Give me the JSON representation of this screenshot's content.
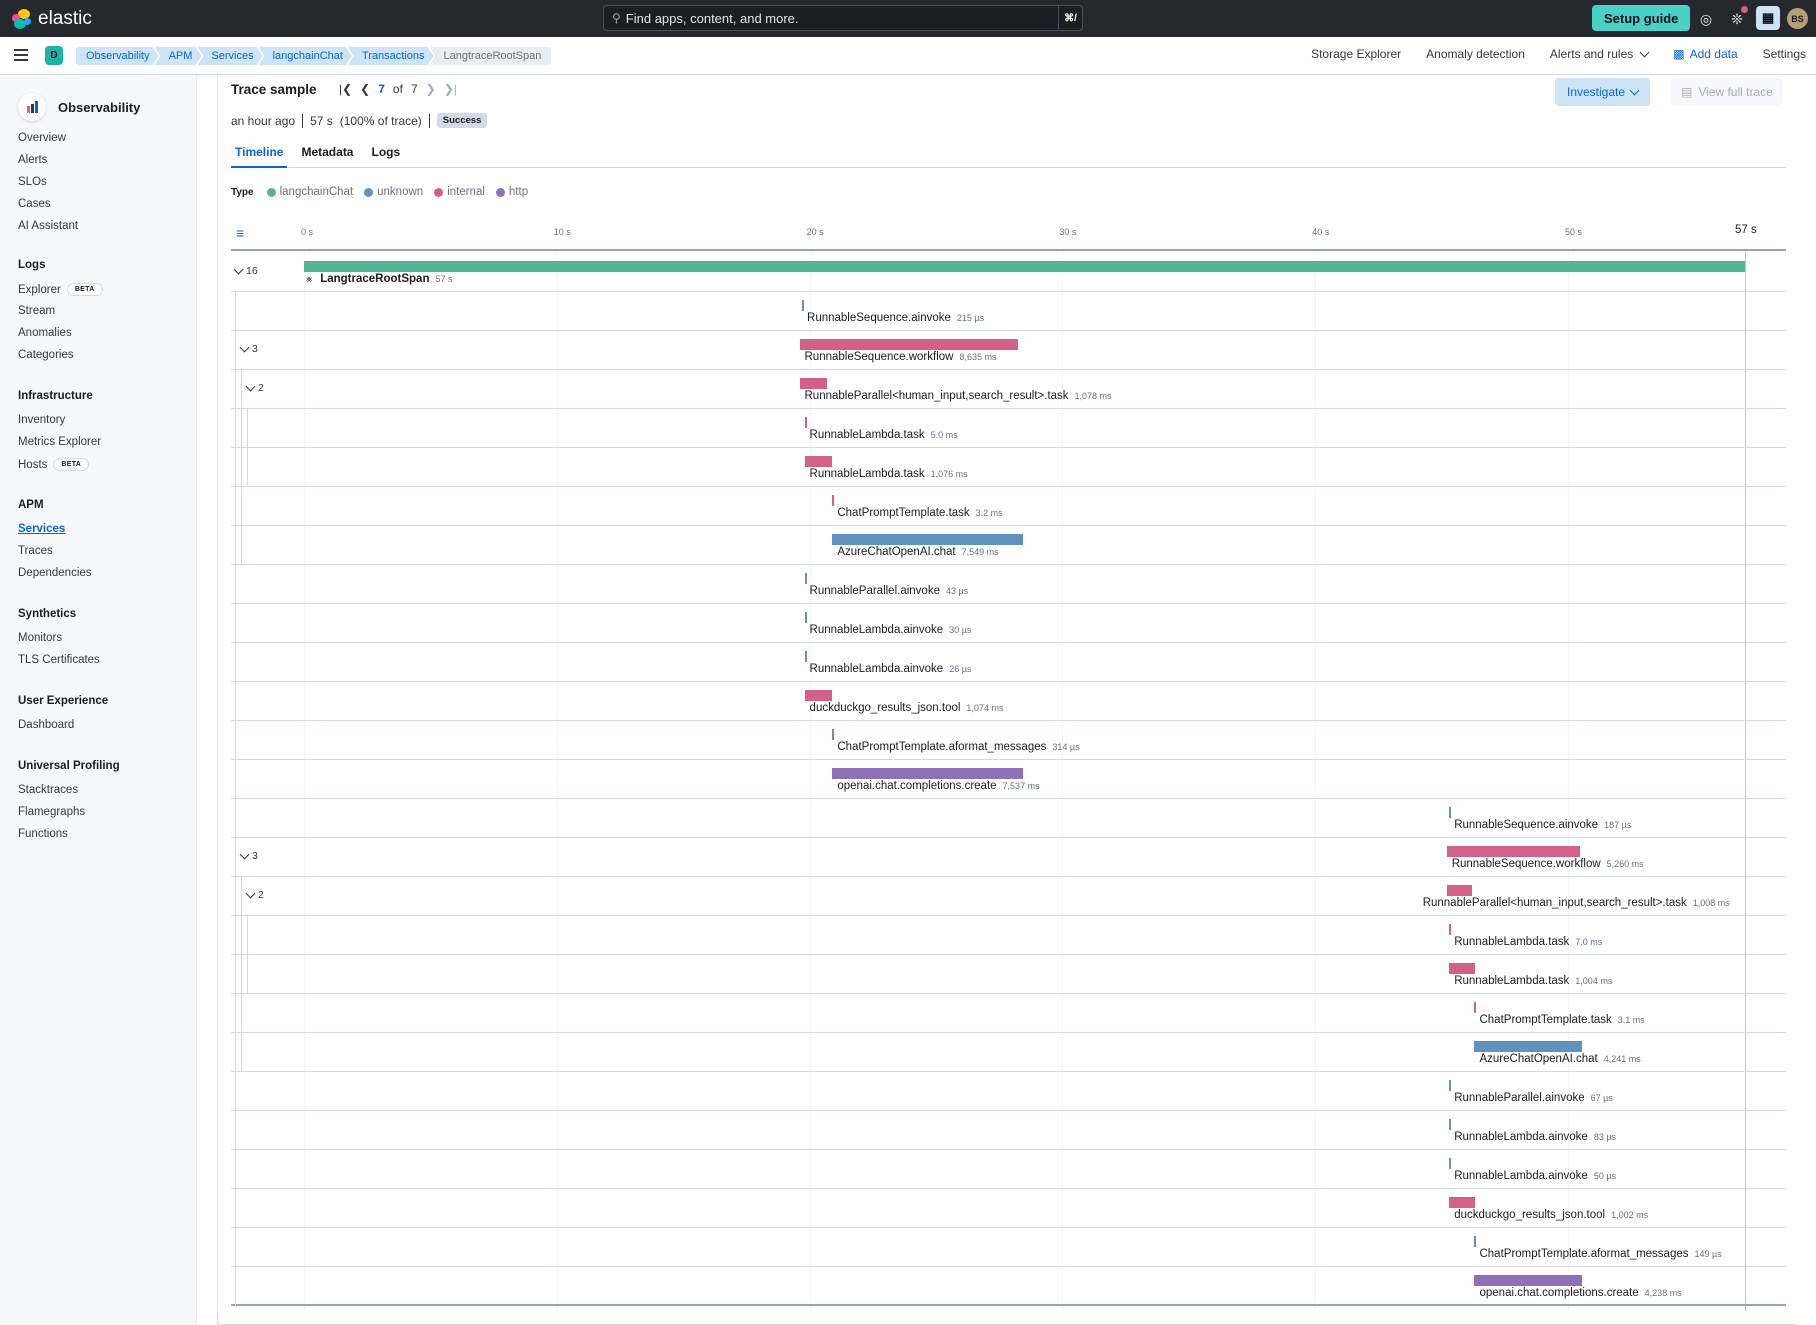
{
  "topbar": {
    "brand": "elastic",
    "search_placeholder": "Find apps, content, and more.",
    "search_shortcut": "⌘/",
    "setup_guide_label": "Setup guide",
    "avatar_initials": "BS"
  },
  "subbar": {
    "space_initial": "D",
    "breadcrumbs": [
      "Observability",
      "APM",
      "Services",
      "langchainChat",
      "Transactions",
      "LangtraceRootSpan"
    ],
    "nav": {
      "storage_explorer": "Storage Explorer",
      "anomaly_detection": "Anomaly detection",
      "alerts_and_rules": "Alerts and rules",
      "add_data": "Add data",
      "settings": "Settings"
    }
  },
  "sidebar": {
    "title": "Observability",
    "top_items": [
      "Overview",
      "Alerts",
      "SLOs",
      "Cases",
      "AI Assistant"
    ],
    "groups": [
      {
        "title": "Logs",
        "items": [
          {
            "label": "Explorer",
            "badge": "BETA"
          },
          {
            "label": "Stream"
          },
          {
            "label": "Anomalies"
          },
          {
            "label": "Categories"
          }
        ]
      },
      {
        "title": "Infrastructure",
        "items": [
          {
            "label": "Inventory"
          },
          {
            "label": "Metrics Explorer"
          },
          {
            "label": "Hosts",
            "badge": "BETA"
          }
        ]
      },
      {
        "title": "APM",
        "items": [
          {
            "label": "Services",
            "active": true
          },
          {
            "label": "Traces"
          },
          {
            "label": "Dependencies"
          }
        ]
      },
      {
        "title": "Synthetics",
        "items": [
          {
            "label": "Monitors"
          },
          {
            "label": "TLS Certificates"
          }
        ]
      },
      {
        "title": "User Experience",
        "items": [
          {
            "label": "Dashboard"
          }
        ]
      },
      {
        "title": "Universal Profiling",
        "items": [
          {
            "label": "Stacktraces"
          },
          {
            "label": "Flamegraphs"
          },
          {
            "label": "Functions"
          }
        ]
      }
    ]
  },
  "trace": {
    "title": "Trace sample",
    "current": "7",
    "of_label": "of",
    "total": "7",
    "age": "an hour ago",
    "duration": "57 s",
    "percent": "(100% of trace)",
    "status": "Success",
    "investigate_label": "Investigate",
    "view_full_trace_label": "View full trace",
    "tabs": [
      "Timeline",
      "Metadata",
      "Logs"
    ],
    "active_tab": "Timeline"
  },
  "legend": {
    "label": "Type",
    "items": [
      {
        "name": "langchainChat",
        "color": "#54b399"
      },
      {
        "name": "unknown",
        "color": "#6092c0"
      },
      {
        "name": "internal",
        "color": "#d36086"
      },
      {
        "name": "http",
        "color": "#9170b8"
      }
    ]
  },
  "timeline": {
    "total_seconds": 57,
    "ticks": [
      "0 s",
      "10 s",
      "20 s",
      "30 s",
      "40 s",
      "50 s"
    ],
    "tick_values": [
      0,
      10,
      20,
      30,
      40,
      50
    ],
    "end_label": "57 s",
    "spans": [
      {
        "name": "LangtraceRootSpan",
        "duration": "57 s",
        "type": "langchainChat",
        "start_s": 0,
        "dur_s": 57,
        "depth": 0,
        "children": "16",
        "root": true
      },
      {
        "name": "RunnableSequence.ainvoke",
        "duration": "215 µs",
        "type": "unknown",
        "start_s": 19.7,
        "dur_s": 0.0002,
        "depth": 1
      },
      {
        "name": "RunnableSequence.workflow",
        "duration": "8,635 ms",
        "type": "internal",
        "start_s": 19.6,
        "dur_s": 8.635,
        "depth": 1,
        "children": "3"
      },
      {
        "name": "RunnableParallel<human_input,search_result>.task",
        "duration": "1,078 ms",
        "type": "internal",
        "start_s": 19.6,
        "dur_s": 1.078,
        "depth": 2,
        "children": "2"
      },
      {
        "name": "RunnableLambda.task",
        "duration": "5.0 ms",
        "type": "internal",
        "start_s": 19.8,
        "dur_s": 0.005,
        "depth": 3
      },
      {
        "name": "RunnableLambda.task",
        "duration": "1,076 ms",
        "type": "internal",
        "start_s": 19.8,
        "dur_s": 1.076,
        "depth": 3
      },
      {
        "name": "ChatPromptTemplate.task",
        "duration": "3.2 ms",
        "type": "internal",
        "start_s": 20.9,
        "dur_s": 0.0032,
        "depth": 2
      },
      {
        "name": "AzureChatOpenAI.chat",
        "duration": "7,549 ms",
        "type": "unknown",
        "start_s": 20.9,
        "dur_s": 7.549,
        "depth": 2
      },
      {
        "name": "RunnableParallel.ainvoke",
        "duration": "43 µs",
        "type": "unknown",
        "start_s": 19.8,
        "dur_s": 4e-05,
        "depth": 1
      },
      {
        "name": "RunnableLambda.ainvoke",
        "duration": "30 µs",
        "type": "unknown",
        "start_s": 19.8,
        "dur_s": 3e-05,
        "depth": 1
      },
      {
        "name": "RunnableLambda.ainvoke",
        "duration": "26 µs",
        "type": "unknown",
        "start_s": 19.8,
        "dur_s": 3e-05,
        "depth": 1
      },
      {
        "name": "duckduckgo_results_json.tool",
        "duration": "1,074 ms",
        "type": "internal",
        "start_s": 19.8,
        "dur_s": 1.074,
        "depth": 1
      },
      {
        "name": "ChatPromptTemplate.aformat_messages",
        "duration": "314 µs",
        "type": "unknown",
        "start_s": 20.9,
        "dur_s": 0.0003,
        "depth": 1
      },
      {
        "name": "openai.chat.completions.create",
        "duration": "7,537 ms",
        "type": "http",
        "start_s": 20.9,
        "dur_s": 7.537,
        "depth": 1
      },
      {
        "name": "RunnableSequence.ainvoke",
        "duration": "187 µs",
        "type": "unknown",
        "start_s": 45.3,
        "dur_s": 0.0002,
        "depth": 1
      },
      {
        "name": "RunnableSequence.workflow",
        "duration": "5,260 ms",
        "type": "internal",
        "start_s": 45.2,
        "dur_s": 5.26,
        "depth": 1,
        "children": "3"
      },
      {
        "name": "RunnableParallel<human_input,search_result>.task",
        "duration": "1,008 ms",
        "type": "internal",
        "start_s": 45.2,
        "dur_s": 1.008,
        "depth": 2,
        "children": "2"
      },
      {
        "name": "RunnableLambda.task",
        "duration": "7.0 ms",
        "type": "internal",
        "start_s": 45.3,
        "dur_s": 0.007,
        "depth": 3
      },
      {
        "name": "RunnableLambda.task",
        "duration": "1,004 ms",
        "type": "internal",
        "start_s": 45.3,
        "dur_s": 1.004,
        "depth": 3
      },
      {
        "name": "ChatPromptTemplate.task",
        "duration": "3.1 ms",
        "type": "internal",
        "start_s": 46.3,
        "dur_s": 0.0031,
        "depth": 2
      },
      {
        "name": "AzureChatOpenAI.chat",
        "duration": "4,241 ms",
        "type": "unknown",
        "start_s": 46.3,
        "dur_s": 4.241,
        "depth": 2
      },
      {
        "name": "RunnableParallel.ainvoke",
        "duration": "67 µs",
        "type": "unknown",
        "start_s": 45.3,
        "dur_s": 7e-05,
        "depth": 1
      },
      {
        "name": "RunnableLambda.ainvoke",
        "duration": "83 µs",
        "type": "unknown",
        "start_s": 45.3,
        "dur_s": 8e-05,
        "depth": 1
      },
      {
        "name": "RunnableLambda.ainvoke",
        "duration": "50 µs",
        "type": "unknown",
        "start_s": 45.3,
        "dur_s": 5e-05,
        "depth": 1
      },
      {
        "name": "duckduckgo_results_json.tool",
        "duration": "1,002 ms",
        "type": "internal",
        "start_s": 45.3,
        "dur_s": 1.002,
        "depth": 1
      },
      {
        "name": "ChatPromptTemplate.aformat_messages",
        "duration": "149 µs",
        "type": "unknown",
        "start_s": 46.3,
        "dur_s": 0.00015,
        "depth": 1
      },
      {
        "name": "openai.chat.completions.create",
        "duration": "4,238 ms",
        "type": "http",
        "start_s": 46.3,
        "dur_s": 4.238,
        "depth": 1
      }
    ]
  }
}
